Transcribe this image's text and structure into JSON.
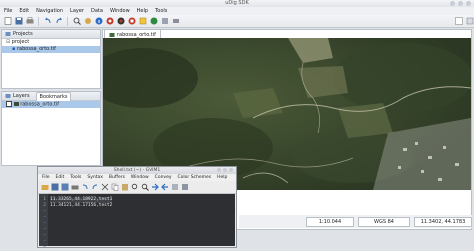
{
  "app": {
    "title": "uDig SDK"
  },
  "menu": [
    "File",
    "Edit",
    "Navigation",
    "Layer",
    "Data",
    "Window",
    "Help",
    "Tools"
  ],
  "toolbar_icons": [
    "new-icon",
    "save-icon",
    "print-icon",
    "undo-icon",
    "redo-icon",
    "zoom-icon",
    "pan-icon",
    "info-icon",
    "select-icon",
    "edit-icon",
    "layers-icon",
    "refresh-icon",
    "measure-icon",
    "settings-icon",
    "help-icon"
  ],
  "projects": {
    "tab_label": "Projects",
    "items": [
      {
        "label": "project",
        "selected": false
      },
      {
        "label": "rabossa_orto.tif",
        "selected": true
      }
    ]
  },
  "layers": {
    "tab_label": "Layers",
    "tab2_label": "Bookmarks",
    "items": [
      {
        "label": "rabossa_orto.tif",
        "selected": true
      }
    ]
  },
  "map": {
    "tab_label": "rabossa_orto.tif"
  },
  "status": {
    "scale": "1:10.044",
    "crs": "WGS 84",
    "coords": "11.3402, 44.1783"
  },
  "editor": {
    "title": "Shell.txt (~) - GVIM1",
    "menu": [
      "File",
      "Edit",
      "Tools",
      "Syntax",
      "Buffers",
      "Window",
      "Convey",
      "Color Schemes",
      "Help"
    ],
    "lines": [
      {
        "num": "1",
        "text": "11.33265,44.18922,test1"
      },
      {
        "num": "2",
        "text": "11.34121,44.17156,test2"
      }
    ],
    "empty_markers": [
      "~",
      "~",
      "~",
      "~",
      "~",
      "~",
      "~"
    ]
  }
}
